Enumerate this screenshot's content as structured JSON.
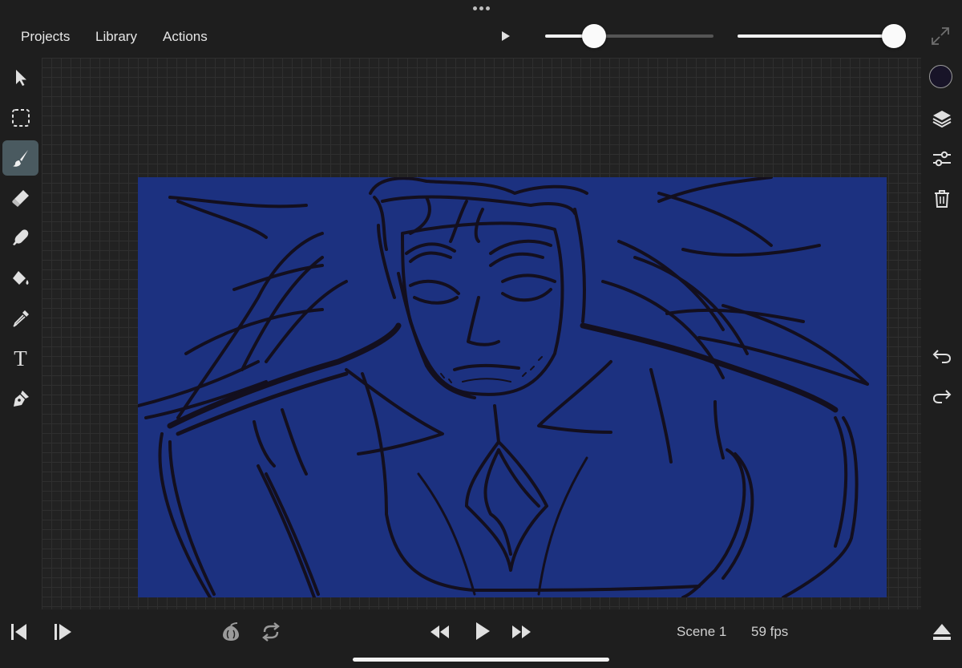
{
  "topbar": {
    "menu": [
      "Projects",
      "Library",
      "Actions"
    ],
    "brush_size": 0.29,
    "opacity": 0.93
  },
  "left_tools": [
    "selection-icon",
    "marquee-icon",
    "brush-icon",
    "eraser-icon",
    "smudge-icon",
    "fill-icon",
    "eyedropper-icon",
    "text-tool-icon",
    "pen-icon"
  ],
  "text_tool_glyph": "T",
  "active_tool": "brush-icon",
  "right_tools": [
    "color-swatch",
    "layers-icon",
    "adjustments-icon",
    "trash-icon",
    "undo-icon",
    "redo-icon"
  ],
  "current_color": "#181428",
  "artboard": {
    "background": "#1c3180",
    "stroke_color": "#130f1e"
  },
  "bottombar": {
    "scene_label": "Scene 1",
    "fps_label": "59 fps"
  }
}
